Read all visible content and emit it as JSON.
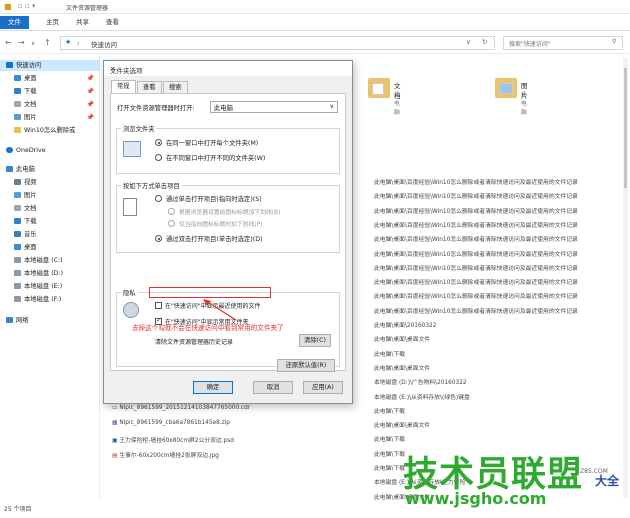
{
  "window": {
    "title": "文件资源管理器"
  },
  "ribbon": {
    "tabs": [
      "文件",
      "主页",
      "共享",
      "查看"
    ]
  },
  "address": {
    "path": "快速访问",
    "search_placeholder": "搜索\"快速访问\""
  },
  "sidebar": {
    "items": [
      {
        "label": "快速访问",
        "pin": ""
      },
      {
        "label": "桌面",
        "pin": "📌"
      },
      {
        "label": "下载",
        "pin": "📌"
      },
      {
        "label": "文档",
        "pin": "📌"
      },
      {
        "label": "图片",
        "pin": "📌"
      },
      {
        "label": "Win10怎么删除或",
        "pin": ""
      },
      {
        "label": "OneDrive",
        "pin": ""
      },
      {
        "label": "此电脑",
        "pin": ""
      },
      {
        "label": "视频",
        "pin": ""
      },
      {
        "label": "图片",
        "pin": ""
      },
      {
        "label": "文档",
        "pin": ""
      },
      {
        "label": "下载",
        "pin": ""
      },
      {
        "label": "音乐",
        "pin": ""
      },
      {
        "label": "桌面",
        "pin": ""
      },
      {
        "label": "本地磁盘 (C:)",
        "pin": ""
      },
      {
        "label": "本地磁盘 (D:)",
        "pin": ""
      },
      {
        "label": "本地磁盘 (E:)",
        "pin": ""
      },
      {
        "label": "本地磁盘 (F:)",
        "pin": ""
      },
      {
        "label": "网络",
        "pin": ""
      }
    ]
  },
  "folders": [
    {
      "name": "文档",
      "sub": "此电脑"
    },
    {
      "name": "图片",
      "sub": "此电脑"
    }
  ],
  "recent_paths": [
    "此电脑\\桌面\\百度经验\\Win10怎么删除或者清除快速访问及最近使用的文件记录",
    "此电脑\\桌面\\百度经验\\Win10怎么删除或者清除快速访问及最近使用的文件记录",
    "此电脑\\桌面\\百度经验\\Win10怎么删除或者清除快速访问及最近使用的文件记录",
    "此电脑\\桌面\\百度经验\\Win10怎么删除或者清除快速访问及最近使用的文件记录",
    "此电脑\\桌面\\百度经验\\Win10怎么删除或者清除快速访问及最近使用的文件记录",
    "此电脑\\桌面\\百度经验\\Win10怎么删除或者清除快速访问及最近使用的文件记录",
    "此电脑\\桌面\\百度经验\\Win10怎么删除或者清除快速访问及最近使用的文件记录",
    "此电脑\\桌面\\百度经验\\Win10怎么删除或者清除快速访问及最近使用的文件记录",
    "此电脑\\桌面\\百度经验\\Win10怎么删除或者清除快速访问及最近使用的文件记录",
    "此电脑\\桌面\\百度经验\\Win10怎么删除或者清除快速访问及最近使用的文件记录",
    "此电脑\\桌面\\20160322",
    "此电脑\\桌面\\桌面文件",
    "此电脑\\下载",
    "此电脑\\桌面\\桌面文件",
    "本地磁盘 (D:)\\广告物料\\20160322",
    "本地磁盘 (E:)\\从资料存放\\(绿色)键盘",
    "此电脑\\下载",
    "此电脑\\桌面\\桌面文件",
    "此电脑\\下载",
    "此电脑\\下载",
    "此电脑\\下载",
    "本地磁盘 (E:)\\从资料存放\\王力保险",
    "此电脑\\桌面\\桌面文件"
  ],
  "files": [
    "Nipic_8961599_20151214103847765000.cdr",
    "Nipic_8961599_cba6a7861b145e8.zip",
    "王力保险柜-墙挂60x80cm屏2公分双边.psd",
    "生事尔-60x200cm墙挂2张屏双边.jpg"
  ],
  "status": {
    "count": "25 个项目"
  },
  "dialog": {
    "title": "文件夹选项",
    "close": "✕",
    "tabs": [
      "常规",
      "查看",
      "搜索"
    ],
    "open_with_label": "打开文件资源管理器时打开:",
    "open_with_value": "此电脑",
    "browse_group": "浏览文件夹",
    "browse_opt1": "在同一窗口中打开每个文件夹(M)",
    "browse_opt2": "在不同窗口中打开不同的文件夹(W)",
    "click_group": "按如下方式单击项目",
    "click_opt1": "通过单击打开项目(指向时选定)(S)",
    "click_sub1": "根据浏览器设置给图标标题加下划线(B)",
    "click_sub2": "仅当指向图标标题时加下划线(P)",
    "click_opt2": "通过双击打开项目(单击时选定)(D)",
    "privacy_group": "隐私",
    "privacy_chk1": "在\"快速访问\"中显示最近使用的文件",
    "privacy_chk2": "在\"快速访问\"中显示常用文件夹",
    "clear_label": "清除文件资源管理器历史记录",
    "clear_btn": "清除(C)",
    "restore_btn": "还原默认值(R)",
    "ok": "确定",
    "cancel": "取消",
    "apply": "应用(A)"
  },
  "annotation": "去掉这个勾就不会在快速访问中看到常用的文件夹了",
  "watermark": {
    "main": "技术员联盟",
    "url": "www.jsgho.com",
    "side": "大全",
    "small": "Z85.COM"
  }
}
